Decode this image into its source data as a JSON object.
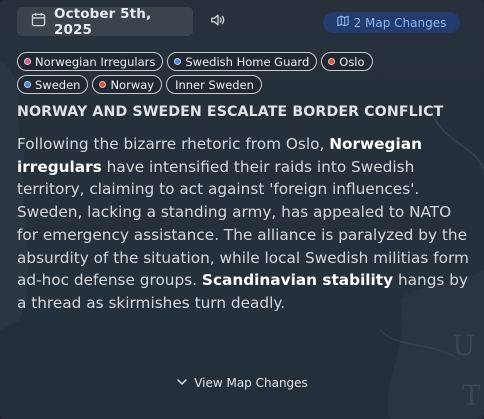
{
  "header": {
    "date": "October 5th, 2025",
    "map_changes_label": "2 Map Changes"
  },
  "tags": [
    [
      {
        "label": "Norwegian Irregulars",
        "dot_color": "#d05a8a"
      },
      {
        "label": "Swedish Home Guard",
        "dot_color": "#4a87d6"
      },
      {
        "label": "Oslo",
        "dot_color": "#d2553d"
      }
    ],
    [
      {
        "label": "Sweden",
        "dot_color": "#4a87d6"
      },
      {
        "label": "Norway",
        "dot_color": "#d2553d"
      },
      {
        "label": "Inner Sweden",
        "dot_color": null
      }
    ]
  ],
  "article": {
    "headline": "NORWAY AND SWEDEN ESCALATE BORDER CONFLICT",
    "segments": [
      {
        "text": "Following the bizarre rhetoric from Oslo, ",
        "bold": false
      },
      {
        "text": "Norwegian irregulars",
        "bold": true
      },
      {
        "text": " have intensified their raids into Swedish territory, claiming to act against 'foreign influences'. Sweden, lacking a standing army, has appealed to NATO for emergency assistance. The alliance is paralyzed by the absurdity of the situation, while local Swedish militias form ad-hoc defense groups. ",
        "bold": false
      },
      {
        "text": "Scandinavian stability",
        "bold": true
      },
      {
        "text": " hangs by a thread as skirmishes turn deadly.",
        "bold": false
      }
    ]
  },
  "footer": {
    "view_changes_label": "View Map Changes"
  },
  "colors": {
    "badge_bg": "#223c6e",
    "badge_text": "#8fb4f2",
    "panel_bg": "#27313b"
  },
  "map_background_letters": [
    "U",
    "T"
  ]
}
